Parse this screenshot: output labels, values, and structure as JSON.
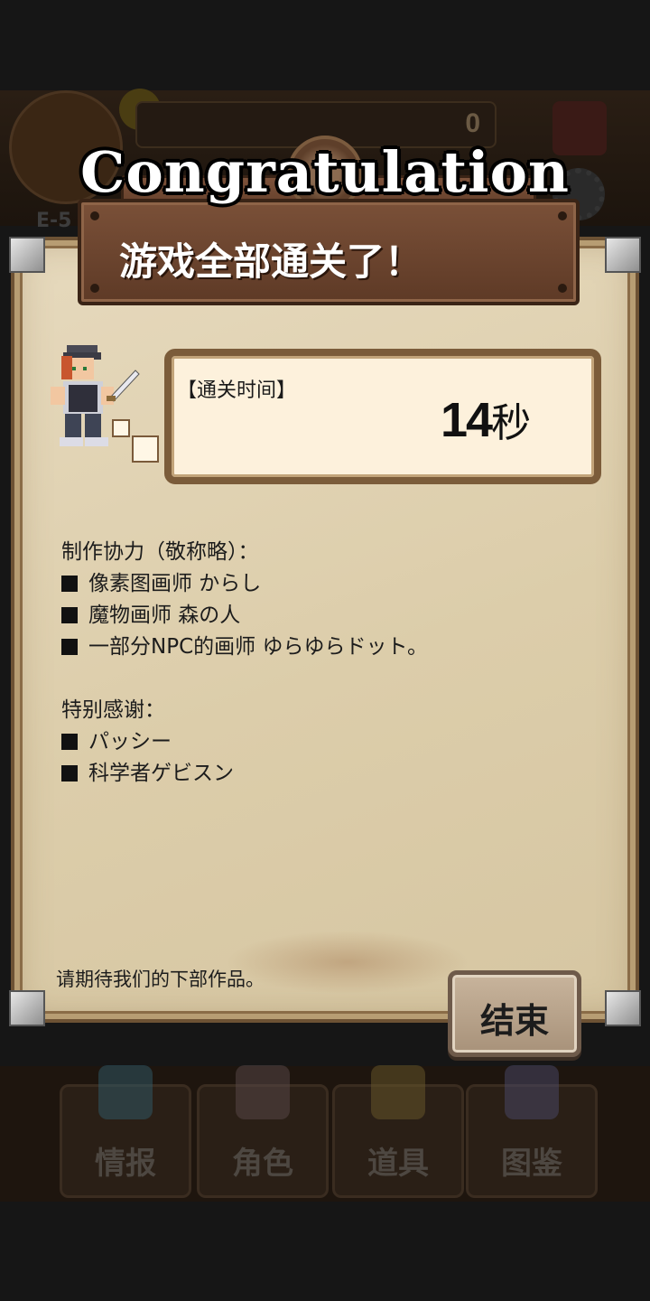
{
  "background": {
    "level_label": "E-5",
    "counter_value": "0",
    "nav": [
      {
        "label": "情报",
        "icon": "info-icon"
      },
      {
        "label": "角色",
        "icon": "character-icon"
      },
      {
        "label": "道具",
        "icon": "item-chest-icon"
      },
      {
        "label": "图鉴",
        "icon": "encyclopedia-icon"
      }
    ]
  },
  "dialog": {
    "banner": "Congratulation",
    "title": "游戏全部通关了！",
    "clear_time": {
      "label": "【通关时间】",
      "value": "14",
      "unit": "秒"
    },
    "credits": {
      "heading": "制作协力（敬称略）：",
      "items": [
        "像素图画师 からし",
        "魔物画师 森の人",
        "一部分NPC的画师 ゆらゆらドット。"
      ]
    },
    "thanks": {
      "heading": "特别感谢：",
      "items": [
        "パッシー",
        "科学者ゲビスン"
      ]
    },
    "footer": "请期待我们的下部作品。",
    "end_button": "结束"
  }
}
